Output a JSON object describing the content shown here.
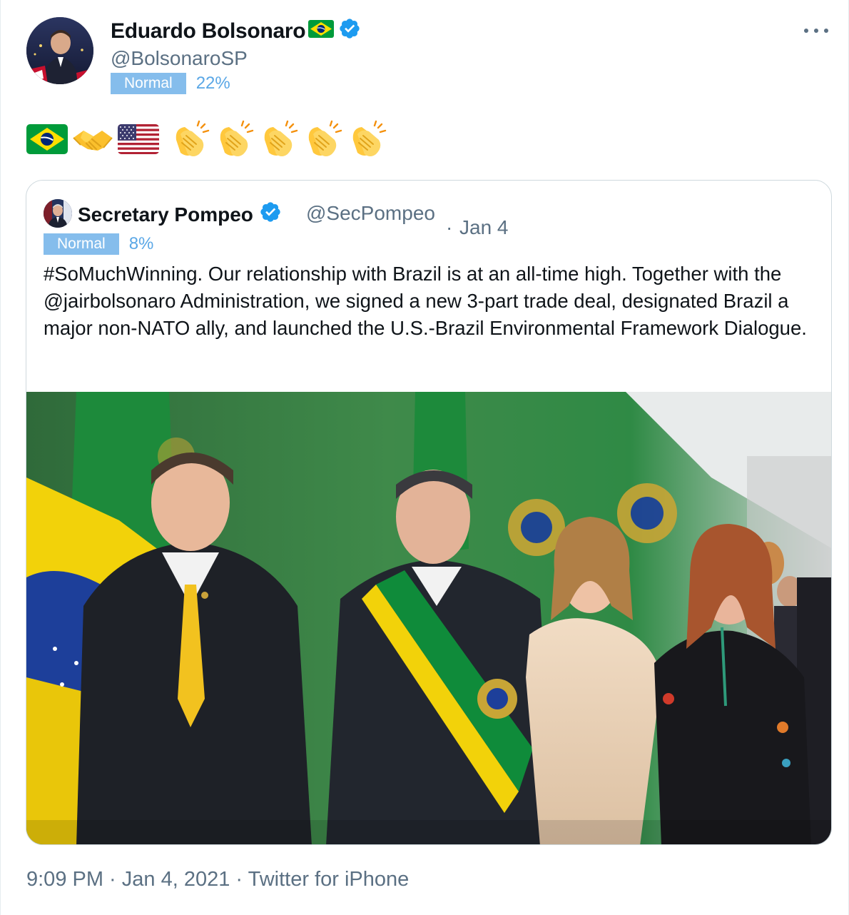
{
  "tweet": {
    "author": {
      "name": "Eduardo Bolsonaro",
      "name_flag_icon": "brazil-flag-icon",
      "verified_icon": "verified-badge-icon",
      "handle": "@BolsonaroSP"
    },
    "badge": {
      "label": "Normal",
      "percent": "22%"
    },
    "more_icon": "more-dots-icon",
    "emoji_text": [
      "brazil-flag-icon",
      "handshake-icon",
      "usa-flag-icon",
      "clapping-hands-icon",
      "clapping-hands-icon",
      "clapping-hands-icon",
      "clapping-hands-icon",
      "clapping-hands-icon"
    ],
    "timestamp": "9:09 PM · Jan 4, 2021 · ",
    "source": "Twitter for iPhone"
  },
  "quoted": {
    "name": "Secretary Pompeo",
    "verified_icon": "verified-badge-icon",
    "handle": "@SecPompeo",
    "separator": "·",
    "date": "Jan 4",
    "badge": {
      "label": "Normal",
      "percent": "8%"
    },
    "text": "#SoMuchWinning. Our relationship with Brazil is at an all-time high. Together with the @jairbolsonaro Administration, we signed a new 3-part trade deal, designated Brazil a major non-NATO ally, and launched the U.S.-Brazil Environmental Framework Dialogue.",
    "photo": "photo-four-people-brazil-flags"
  },
  "colors": {
    "text": "#0f1419",
    "secondary": "#5b7083",
    "badge_bg": "#85bdec",
    "badge_pct": "#5aa7e6",
    "verified": "#1d9bf0",
    "border": "#cfd9de"
  }
}
